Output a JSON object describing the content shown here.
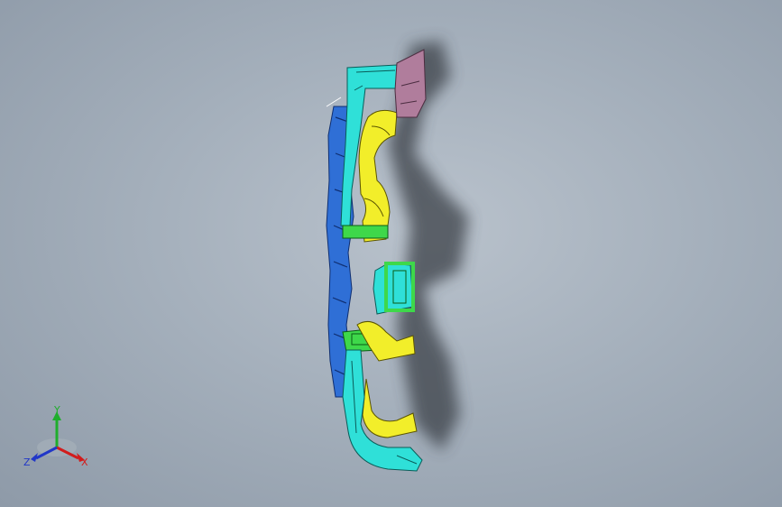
{
  "viewport": {
    "background_top": "#b9c2cc",
    "background_bottom": "#8e9aa8"
  },
  "model": {
    "colors": {
      "blue_panel": "#2f6fd6",
      "cyan_duct": "#2fe0d8",
      "yellow_duct": "#f2ee2a",
      "green_bracket": "#3ed84a",
      "mauve_mount": "#b07d9c",
      "shadow": "#3b3f46"
    }
  },
  "triad": {
    "x_label": "X",
    "y_label": "Y",
    "z_label": "Z",
    "x_color": "#d21c1c",
    "y_color": "#1fae2c",
    "z_color": "#2137c8"
  }
}
